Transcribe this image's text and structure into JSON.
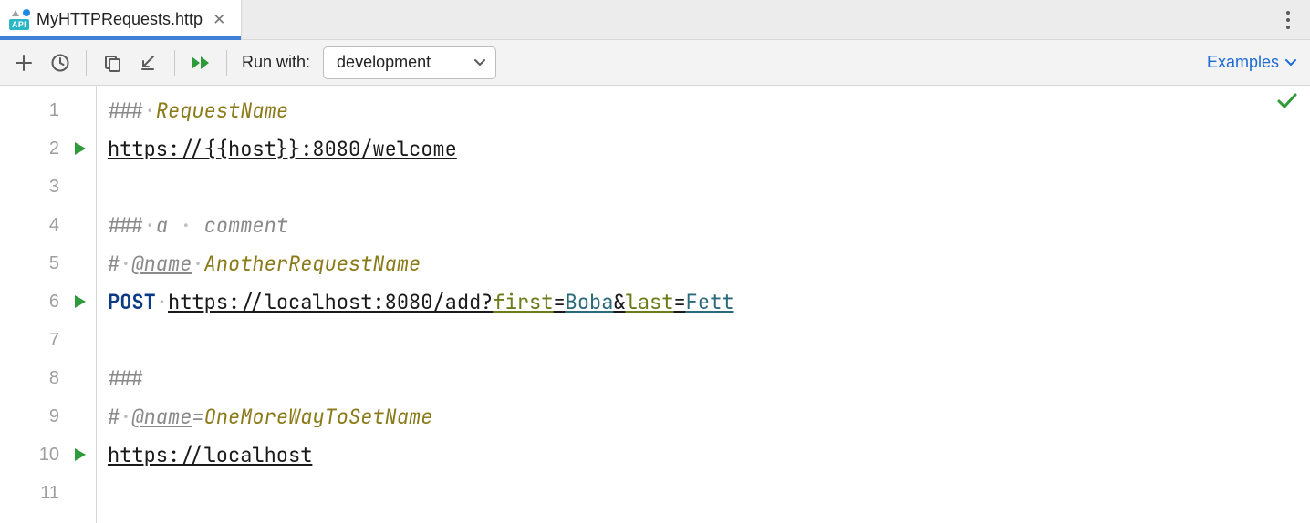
{
  "tab": {
    "title": "MyHTTPRequests.http"
  },
  "toolbar": {
    "run_with_label": "Run with:",
    "env_selected": "development",
    "examples_label": "Examples"
  },
  "gutter": {
    "lines": [
      "1",
      "2",
      "3",
      "4",
      "5",
      "6",
      "7",
      "8",
      "9",
      "10",
      "11"
    ],
    "run_markers": [
      2,
      6,
      10
    ]
  },
  "code": {
    "l1": {
      "hash": "### ",
      "name": "RequestName"
    },
    "l2": {
      "url": "https://{{host}}:8080/welcome"
    },
    "l4": {
      "hash": "### ",
      "text": "a comment"
    },
    "l5": {
      "hash": "# ",
      "anno": "@name",
      "val": "AnotherRequestName"
    },
    "l6": {
      "method": "POST",
      "base": "https://localhost:8080/add?",
      "p1": "first",
      "eq1": "=",
      "v1": "Boba",
      "amp": "&",
      "p2": "last",
      "eq2": "=",
      "v2": "Fett"
    },
    "l8": {
      "hash": "###"
    },
    "l9": {
      "hash": "# ",
      "anno": "@name",
      "eq": "=",
      "val": "OneMoreWayToSetName"
    },
    "l10": {
      "url": "https://localhost"
    }
  },
  "icons": {
    "api_badge": "API"
  }
}
